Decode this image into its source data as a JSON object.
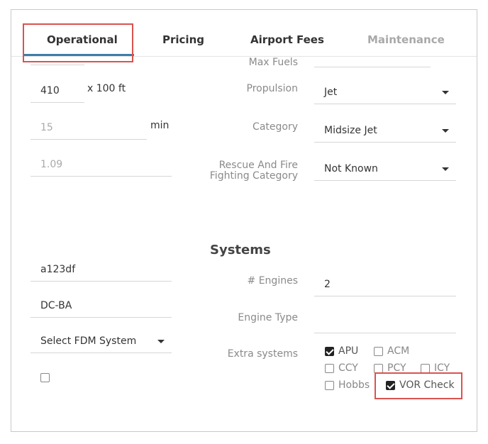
{
  "tabs": [
    {
      "label": "Operational",
      "active": true
    },
    {
      "label": "Pricing",
      "active": false
    },
    {
      "label": "Airport Fees",
      "active": false
    },
    {
      "label": "Maintenance",
      "active": false,
      "disabled": true
    }
  ],
  "left": {
    "runway_value": "410",
    "runway_unit": "x 100 ft",
    "time_value": "15",
    "time_unit": "min",
    "factor_value": "1.09",
    "serial_value": "a123df",
    "code_value": "DC-BA",
    "fdm_select": "Select FDM System",
    "fdm_checkbox_checked": false
  },
  "right": {
    "max_fuels_label": "Max Fuels",
    "propulsion_label": "Propulsion",
    "propulsion_value": "Jet",
    "category_label": "Category",
    "category_value": "Midsize Jet",
    "rescue_label": "Rescue And Fire Fighting Category",
    "rescue_value": "Not Known"
  },
  "systems": {
    "title": "Systems",
    "engines_label": "# Engines",
    "engines_value": "2",
    "engine_type_label": "Engine Type",
    "engine_type_value": "",
    "extra_label": "Extra systems",
    "extra_systems": [
      {
        "label": "APU",
        "checked": true
      },
      {
        "label": "ACM",
        "checked": false
      },
      {
        "label": "CCY",
        "checked": false
      },
      {
        "label": "PCY",
        "checked": false
      },
      {
        "label": "ICY",
        "checked": false
      },
      {
        "label": "Hobbs",
        "checked": false
      },
      {
        "label": "VOR Check",
        "checked": true
      }
    ]
  },
  "colors": {
    "accent": "#3d7ea6",
    "highlight": "#d9534f",
    "label_gray": "#8a8a8a"
  }
}
